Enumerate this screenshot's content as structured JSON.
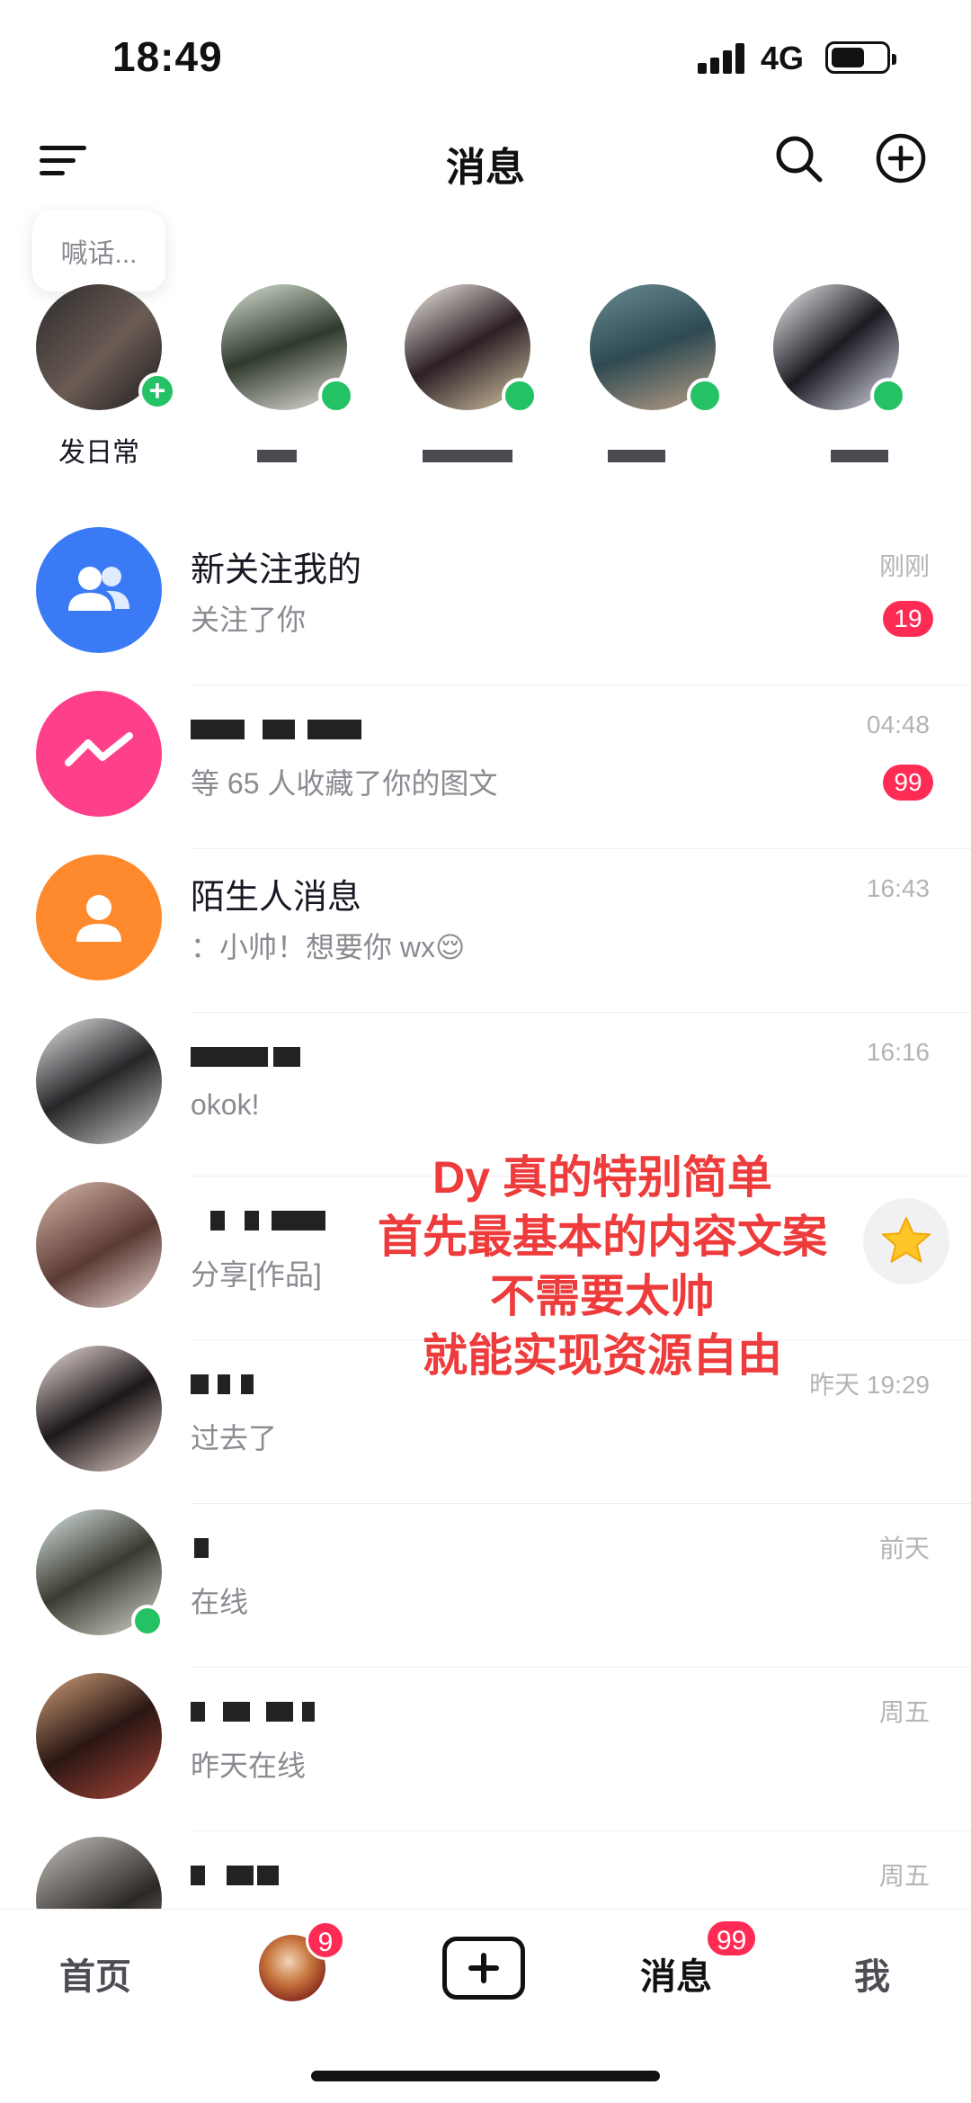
{
  "status_bar": {
    "time": "18:49",
    "network": "4G"
  },
  "header": {
    "title": "消息"
  },
  "shout_bubble": {
    "text": "喊话..."
  },
  "stories": [
    {
      "name": "发日常",
      "is_self": true
    },
    {
      "name": ""
    },
    {
      "name": ""
    },
    {
      "name": ""
    },
    {
      "name": ""
    }
  ],
  "conversations": [
    {
      "name": "新关注我的",
      "preview": "关注了你",
      "time": "刚刚",
      "badge": "19",
      "icon": "fans-icon",
      "color": "#3a7bf5"
    },
    {
      "name": "",
      "preview": "等 65 人收藏了你的图文",
      "time": "04:48",
      "badge": "99",
      "icon": "interaction-icon",
      "color": "#fe3f8a"
    },
    {
      "name": "陌生人消息",
      "preview": "：小帅！想要你 wx😌",
      "time": "16:43",
      "badge": "",
      "icon": "stranger-icon",
      "color": "#ff8a2d"
    },
    {
      "name": "",
      "preview": "okok!",
      "time": "16:16",
      "badge": ""
    },
    {
      "name": "",
      "preview": "分享[作品]",
      "time": "",
      "badge": ""
    },
    {
      "name": "",
      "preview": "过去了",
      "time": "昨天 19:29",
      "badge": ""
    },
    {
      "name": "",
      "preview": "在线",
      "time": "前天",
      "badge": "",
      "online": true
    },
    {
      "name": "",
      "preview": "昨天在线",
      "time": "周五",
      "badge": ""
    },
    {
      "name": "",
      "preview": "",
      "time": "周五",
      "badge": ""
    }
  ],
  "promo_text": {
    "line1": "Dy 真的特别简单",
    "line2": "首先最基本的内容文案",
    "line3": "不需要太帅",
    "line4": "就能实现资源自由"
  },
  "tab_bar": {
    "home": "首页",
    "friends_badge": "9",
    "messages": "消息",
    "messages_badge": "99",
    "me": "我"
  },
  "colors": {
    "accent": "#fe2c55",
    "online": "#25c165",
    "promo": "#ee3b3b"
  }
}
